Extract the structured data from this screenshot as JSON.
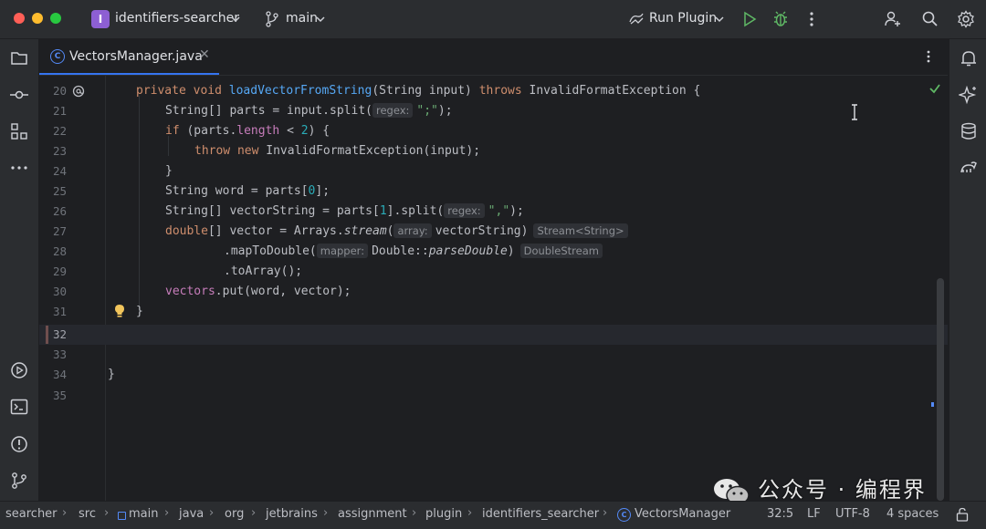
{
  "titlebar": {
    "project_badge": "I",
    "project_name": "identifiers-searcher",
    "branch": "main",
    "run_config": "Run Plugin"
  },
  "tab": {
    "icon_letter": "C",
    "filename": "VectorsManager.java",
    "close": "✕"
  },
  "editor": {
    "hints": {
      "regex": "regex:",
      "array": "array:",
      "mapper": "mapper:",
      "stream_type": "Stream<String>",
      "double_stream": "DoubleStream"
    },
    "lines": [
      {
        "num": "20",
        "t0": "private",
        "t1": " ",
        "t2": "void",
        "t3": " ",
        "t4": "loadVectorFromString",
        "t5": "(String input) ",
        "t6": "throws",
        "t7": " InvalidFormatException {"
      },
      {
        "num": "21",
        "t0": "String[] parts = input.split(",
        "t1": "\";\"",
        "t2": ");"
      },
      {
        "num": "22",
        "t0": "if",
        "t1": " (parts.",
        "t2": "length",
        "t3": " < ",
        "t4": "2",
        "t5": ") {"
      },
      {
        "num": "23",
        "t0": "throw",
        "t1": " ",
        "t2": "new",
        "t3": " InvalidFormatException(input);"
      },
      {
        "num": "24",
        "t0": "}"
      },
      {
        "num": "25",
        "t0": "String word = parts[",
        "t1": "0",
        "t2": "];"
      },
      {
        "num": "26",
        "t0": "String[] vectorString = parts[",
        "t1": "1",
        "t2": "].split(",
        "t3": "\",\"",
        "t4": ");"
      },
      {
        "num": "27",
        "t0": "double",
        "t1": "[] vector = Arrays.",
        "t2": "stream",
        "t3": "(",
        "t4": "vectorString)"
      },
      {
        "num": "28",
        "t0": ".mapToDouble(",
        "t1": "Double::",
        "t2": "parseDouble",
        "t3": ")"
      },
      {
        "num": "29",
        "t0": ".toArray();"
      },
      {
        "num": "30",
        "t0": "vectors",
        "t1": ".put(word, vector);"
      },
      {
        "num": "31",
        "t0": "}"
      },
      {
        "num": "32"
      },
      {
        "num": "33"
      },
      {
        "num": "34",
        "t0": "}"
      },
      {
        "num": "35"
      }
    ]
  },
  "statusbar": {
    "crumbs": [
      "searcher",
      "src",
      "main",
      "java",
      "org",
      "jetbrains",
      "assignment",
      "plugin",
      "identifiers_searcher",
      "VectorsManager"
    ],
    "separator": "›",
    "position": "32:5",
    "line_ending": "LF",
    "encoding": "UTF-8",
    "indent": "4 spaces"
  },
  "watermark": {
    "text": "公众号 · 编程界"
  },
  "colors": {
    "accent": "#3574f0",
    "keyword": "#cf8e6d",
    "function": "#56a8f5",
    "string": "#6aab73",
    "number": "#2aacb8",
    "field": "#c77dbb"
  }
}
